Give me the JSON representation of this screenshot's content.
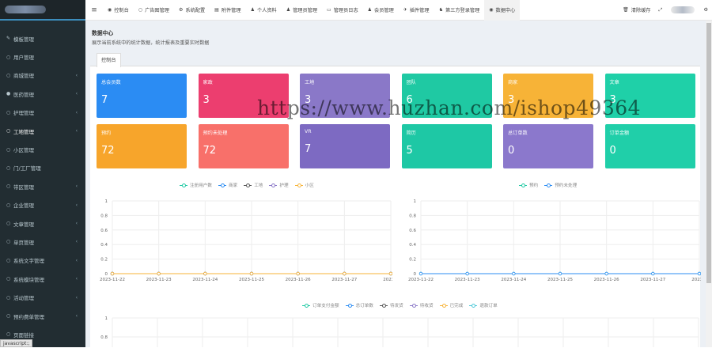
{
  "sidebar": {
    "items": [
      {
        "label": "模板管理",
        "icon": "edit-icon",
        "glyph": "✎",
        "chevron": false
      },
      {
        "label": "用户管理",
        "icon": "circle-icon",
        "glyph": "○",
        "chevron": false
      },
      {
        "label": "商城管理",
        "icon": "circle-icon",
        "glyph": "○",
        "chevron": true
      },
      {
        "label": "医药管理",
        "icon": "gear-icon",
        "glyph": "●",
        "chevron": true
      },
      {
        "label": "护理管理",
        "icon": "circle-icon",
        "glyph": "○",
        "chevron": true
      },
      {
        "label": "工地管理",
        "icon": "circle-icon",
        "glyph": "○",
        "chevron": true,
        "active": true
      },
      {
        "label": "小区管理",
        "icon": "circle-icon",
        "glyph": "○",
        "chevron": false
      },
      {
        "label": "门/工厂管理",
        "icon": "circle-icon",
        "glyph": "○",
        "chevron": false
      },
      {
        "label": "带区管理",
        "icon": "circle-icon",
        "glyph": "○",
        "chevron": true
      },
      {
        "label": "企业管理",
        "icon": "circle-icon",
        "glyph": "○",
        "chevron": true
      },
      {
        "label": "文章管理",
        "icon": "circle-icon",
        "glyph": "○",
        "chevron": true
      },
      {
        "label": "单页管理",
        "icon": "circle-icon",
        "glyph": "○",
        "chevron": true
      },
      {
        "label": "系统文字管理",
        "icon": "circle-icon",
        "glyph": "○",
        "chevron": true
      },
      {
        "label": "系统模块管理",
        "icon": "circle-icon",
        "glyph": "○",
        "chevron": true
      },
      {
        "label": "活动管理",
        "icon": "circle-icon",
        "glyph": "○",
        "chevron": true
      },
      {
        "label": "预约费单管理",
        "icon": "circle-icon",
        "glyph": "○",
        "chevron": true
      },
      {
        "label": "页面链接",
        "icon": "circle-icon",
        "glyph": "○",
        "chevron": false
      }
    ],
    "status_bar": "javascript:;"
  },
  "topbar": {
    "toggle_glyph": "≡",
    "nav": [
      {
        "label": "控制台",
        "glyph": "◉",
        "icon": "dashboard-icon"
      },
      {
        "label": "广告图管理",
        "glyph": "○",
        "icon": "circle-icon"
      },
      {
        "label": "系统配置",
        "glyph": "⚙",
        "icon": "gear-icon"
      },
      {
        "label": "附件管理",
        "glyph": "▤",
        "icon": "attachment-icon"
      },
      {
        "label": "个人资料",
        "glyph": "♟",
        "icon": "user-icon"
      },
      {
        "label": "管理员管理",
        "glyph": "♟",
        "icon": "admin-icon"
      },
      {
        "label": "管理员日志",
        "glyph": "▭",
        "icon": "log-icon"
      },
      {
        "label": "会员管理",
        "glyph": "♟",
        "icon": "member-icon"
      },
      {
        "label": "插件管理",
        "glyph": "✈",
        "icon": "plugin-icon"
      },
      {
        "label": "第三方登录管理",
        "glyph": "♞",
        "icon": "third-party-icon"
      },
      {
        "label": "数据中心",
        "glyph": "◉",
        "icon": "dashboard-icon",
        "active": true
      }
    ],
    "clear_cache": "清除缓存",
    "clear_glyph": "🗑",
    "fullscreen_glyph": "⤢",
    "settings_glyph": "⚙"
  },
  "page": {
    "title": "数据中心",
    "subtitle": "展示当前系统中的统计数据，统计报表及重要实时数据",
    "tab": "控制台"
  },
  "cards": [
    {
      "label": "总会员数",
      "value": "7",
      "color": "#2b8cf3"
    },
    {
      "label": "家政",
      "value": "3",
      "color": "#ec3e6f"
    },
    {
      "label": "工地",
      "value": "3",
      "color": "#8a78c8"
    },
    {
      "label": "团队",
      "value": "6",
      "color": "#1fc9a3"
    },
    {
      "label": "商家",
      "value": "3",
      "color": "#f7b337"
    },
    {
      "label": "文章",
      "value": "3",
      "color": "#1fd0a8"
    },
    {
      "label": "预约",
      "value": "72",
      "color": "#f7a52b"
    },
    {
      "label": "预约未处理",
      "value": "72",
      "color": "#f8706a"
    },
    {
      "label": "VR",
      "value": "7",
      "color": "#7d6ac2"
    },
    {
      "label": "简历",
      "value": "5",
      "color": "#1ec8a5"
    },
    {
      "label": "总订单数",
      "value": "0",
      "color": "#8b78cc"
    },
    {
      "label": "订单金额",
      "value": "0",
      "color": "#20cfa9"
    }
  ],
  "watermark": "https://www.huzhan.com/ishop49364",
  "charts": {
    "left": {
      "legend": [
        {
          "name": "注册用户数",
          "color": "#1fc9a3"
        },
        {
          "name": "商家",
          "color": "#2b8cf3"
        },
        {
          "name": "工地",
          "color": "#555555"
        },
        {
          "name": "护理",
          "color": "#8a78c8"
        },
        {
          "name": "小区",
          "color": "#f7b337"
        }
      ]
    },
    "right": {
      "legend": [
        {
          "name": "预约",
          "color": "#1fc9a3"
        },
        {
          "name": "预约未处理",
          "color": "#2b8cf3"
        }
      ]
    },
    "bottom": {
      "legend": [
        {
          "name": "订单支付金额",
          "color": "#1fc9a3"
        },
        {
          "name": "总订单数",
          "color": "#2b8cf3"
        },
        {
          "name": "待发货",
          "color": "#555555"
        },
        {
          "name": "待收货",
          "color": "#8a78c8"
        },
        {
          "name": "已完成",
          "color": "#f7b337"
        },
        {
          "name": "退款订单",
          "color": "#4fc8d8"
        }
      ]
    }
  },
  "chart_data": [
    {
      "type": "line",
      "x": [
        "2023-11-22",
        "2023-11-23",
        "2023-11-24",
        "2023-11-25",
        "2023-11-26",
        "2023-11-27",
        "2023-1"
      ],
      "series": [
        {
          "name": "注册用户数",
          "values": [
            0,
            0,
            0,
            0,
            0,
            0,
            0
          ]
        },
        {
          "name": "商家",
          "values": [
            0,
            0,
            0,
            0,
            0,
            0,
            0
          ]
        },
        {
          "name": "工地",
          "values": [
            0,
            0,
            0,
            0,
            0,
            0,
            0
          ]
        },
        {
          "name": "护理",
          "values": [
            0,
            0,
            0,
            0,
            0,
            0,
            0
          ]
        },
        {
          "name": "小区",
          "values": [
            0,
            0,
            0,
            0,
            0,
            0,
            0
          ]
        }
      ],
      "yticks": [
        "0",
        "0.2",
        "0.4",
        "0.6",
        "0.8",
        "1"
      ],
      "ylim": [
        0,
        1
      ]
    },
    {
      "type": "line",
      "x": [
        "2023-11-22",
        "2023-11-23",
        "2023-11-24",
        "2023-11-25",
        "2023-11-26",
        "2023-11-27",
        "2023-1"
      ],
      "series": [
        {
          "name": "预约",
          "values": [
            0,
            0,
            0,
            0,
            0,
            0,
            0
          ]
        },
        {
          "name": "预约未处理",
          "values": [
            0,
            0,
            0,
            0,
            0,
            0,
            0
          ]
        }
      ],
      "yticks": [
        "0",
        "0.2",
        "0.4",
        "0.6",
        "0.8",
        "1"
      ],
      "ylim": [
        0,
        1
      ]
    },
    {
      "type": "line",
      "x": [],
      "series": [],
      "yticks": [
        "1",
        "0.8"
      ],
      "ylim": [
        0,
        1
      ]
    }
  ]
}
